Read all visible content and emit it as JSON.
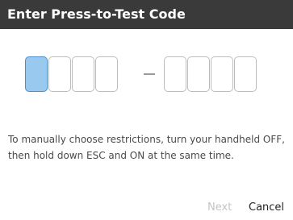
{
  "dialog": {
    "title": "Enter Press-to-Test Code",
    "code_separator": "-",
    "code_boxes": [
      {
        "value": "",
        "active": true
      },
      {
        "value": "",
        "active": false
      },
      {
        "value": "",
        "active": false
      },
      {
        "value": "",
        "active": false
      },
      {
        "value": "",
        "active": false
      },
      {
        "value": "",
        "active": false
      },
      {
        "value": "",
        "active": false
      },
      {
        "value": "",
        "active": false
      }
    ],
    "instructions": "To manually choose restrictions, turn your handheld OFF, then hold down ESC and ON at the same time.",
    "buttons": {
      "next_label": "Next",
      "next_enabled": false,
      "cancel_label": "Cancel"
    },
    "colors": {
      "title_bar": "#3a3a3a",
      "active_box": "#9ac9ef",
      "disabled_text": "#c4c4c4"
    }
  }
}
